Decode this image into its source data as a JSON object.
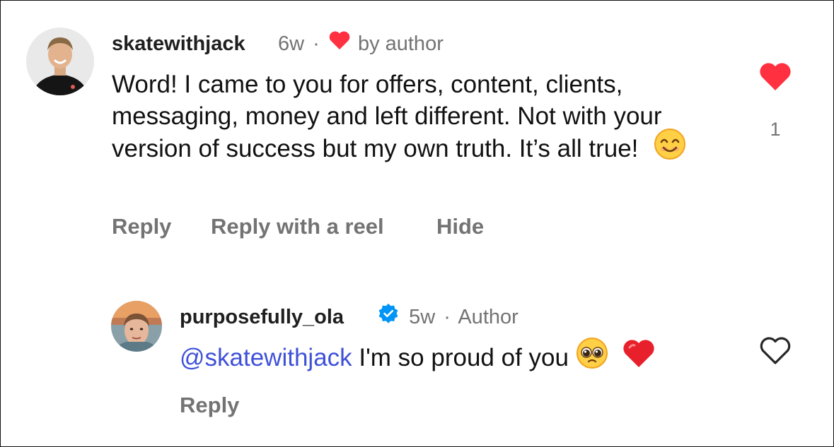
{
  "comment": {
    "username": "skatewithjack",
    "age": "6w",
    "separator": "·",
    "liked_by_author_label": "by author",
    "text": "Word! I came to you for offers, content, clients, messaging, money and left different. Not with your version of success but my own truth. It’s all true!",
    "emoji": "smiling-face-icon",
    "like_count": "1",
    "actions": {
      "reply": "Reply",
      "reply_with_reel": "Reply with a reel",
      "hide": "Hide"
    }
  },
  "reply": {
    "username": "purposefully_ola",
    "verified": true,
    "age": "5w",
    "separator": "·",
    "author_label": "Author",
    "mention": "@skatewithjack",
    "text": " I'm so proud of you",
    "emojis": [
      "pleading-face-icon",
      "red-heart-icon"
    ],
    "actions": {
      "reply": "Reply"
    }
  },
  "colors": {
    "like_red": "#ff3040",
    "muted_gray": "#737373",
    "mention_blue": "#3f51d8",
    "verified_blue": "#0095f6"
  }
}
